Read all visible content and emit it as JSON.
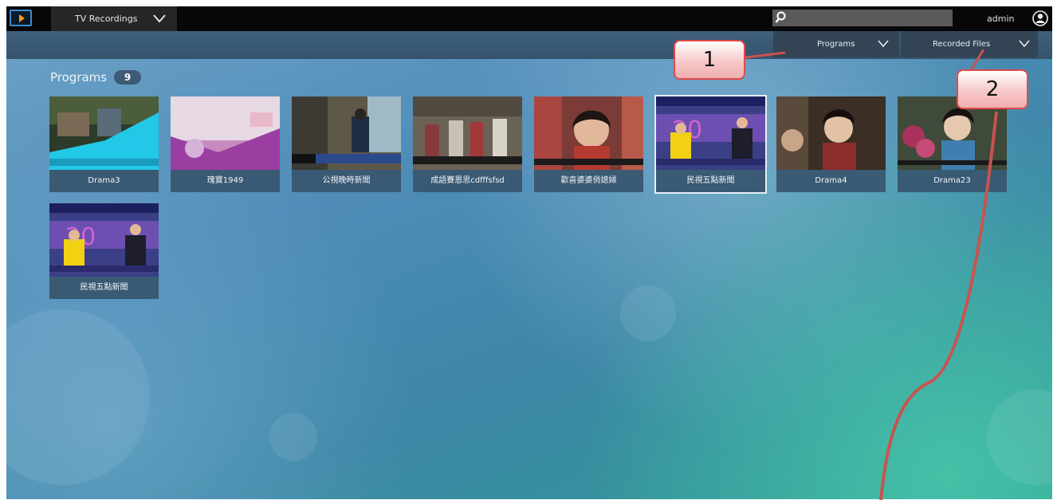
{
  "topbar": {
    "module_label": "TV Recordings",
    "search_placeholder": "",
    "user_name": "admin"
  },
  "subbar": {
    "programs_label": "Programs",
    "recorded_files_label": "Recorded Files"
  },
  "section": {
    "title": "Programs",
    "count": "9"
  },
  "programs": [
    {
      "title": "Drama3",
      "thumb_icon": "outdoor-street-scene"
    },
    {
      "title": "瑰寶1949",
      "thumb_icon": "purple-flower-scene"
    },
    {
      "title": "公視晚時新聞",
      "thumb_icon": "alley-news-scene"
    },
    {
      "title": "成語賽恩思cdfffsfsd",
      "thumb_icon": "classroom-scene"
    },
    {
      "title": "歡喜婆婆俏媳婦",
      "thumb_icon": "drama-woman-closeup"
    },
    {
      "title": "民視五點新聞",
      "thumb_icon": "news-anchors-scene",
      "selected": true
    },
    {
      "title": "Drama4",
      "thumb_icon": "period-drama-scene"
    },
    {
      "title": "Drama23",
      "thumb_icon": "period-drama-flowers-scene"
    },
    {
      "title": "民視五點新聞",
      "thumb_icon": "news-anchors-scene"
    }
  ],
  "annotations": {
    "callout_1": "1",
    "callout_2": "2"
  },
  "colors": {
    "topbar": "#070707",
    "accent_logo": "#3b8bd0",
    "annotation_red": "#c9534f"
  }
}
